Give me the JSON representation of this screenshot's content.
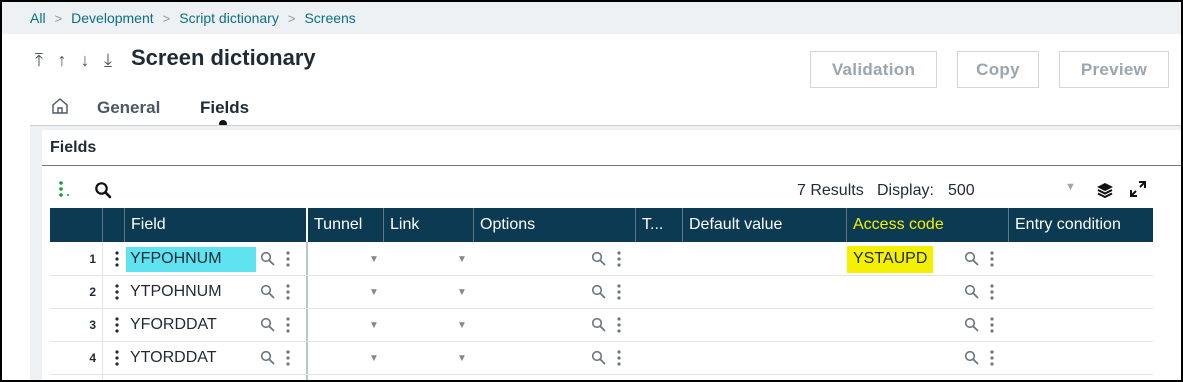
{
  "breadcrumb": [
    "All",
    "Development",
    "Script dictionary",
    "Screens"
  ],
  "header": {
    "title": "Screen dictionary",
    "nav_arrows": [
      "⤒",
      "↑",
      "↓",
      "⤓"
    ],
    "buttons": {
      "validation": "Validation",
      "copy": "Copy",
      "preview": "Preview"
    }
  },
  "tabs": {
    "general": "General",
    "fields": "Fields"
  },
  "section": {
    "title": "Fields"
  },
  "toolbar": {
    "results": "7 Results",
    "display_label": "Display:",
    "display_value": "500"
  },
  "table": {
    "columns": [
      "Field",
      "Tunnel",
      "Link",
      "Options",
      "T...",
      "Default value",
      "Access code",
      "Entry condition"
    ],
    "rows": [
      {
        "num": "1",
        "field": "YFPOHNUM",
        "access_code": "YSTAUPD"
      },
      {
        "num": "2",
        "field": "YTPOHNUM",
        "access_code": ""
      },
      {
        "num": "3",
        "field": "YFORDDAT",
        "access_code": ""
      },
      {
        "num": "4",
        "field": "YTORDDAT",
        "access_code": ""
      }
    ]
  },
  "colors": {
    "header_bg": "#0b3a52",
    "highlight_cyan": "#5fe3f0",
    "highlight_yellow": "#f4f000",
    "link": "#0a6f84"
  }
}
